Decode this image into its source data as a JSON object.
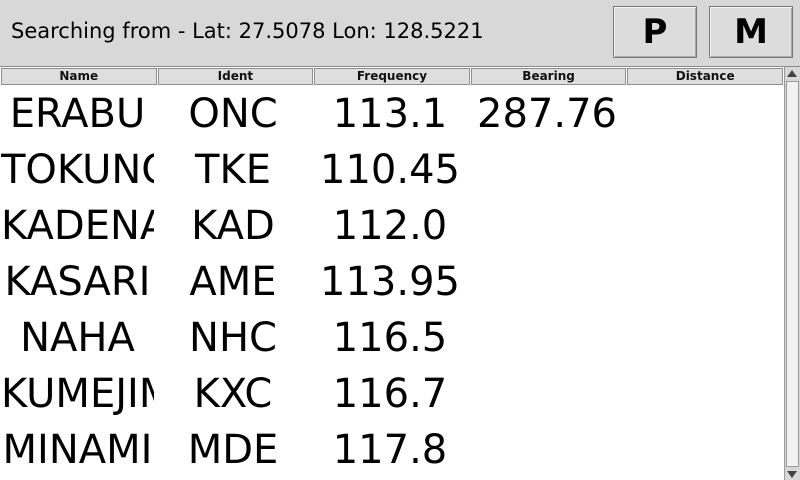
{
  "status": {
    "text": "Searching from - Lat: 27.5078 Lon: 128.5221"
  },
  "buttons": {
    "p_label": "P",
    "m_label": "M"
  },
  "table": {
    "columns": [
      "Name",
      "Ident",
      "Frequency",
      "Bearing",
      "Distance"
    ],
    "rows": [
      {
        "name": "ERABU",
        "ident": "ONC",
        "frequency": "113.1",
        "bearing": "287.76",
        "distance": ""
      },
      {
        "name": "TOKUNOSHIMA",
        "ident": "TKE",
        "frequency": "110.45",
        "bearing": "",
        "distance": ""
      },
      {
        "name": "KADENA",
        "ident": "KAD",
        "frequency": "112.0",
        "bearing": "",
        "distance": ""
      },
      {
        "name": "KASARI",
        "ident": "AME",
        "frequency": "113.95",
        "bearing": "",
        "distance": ""
      },
      {
        "name": "NAHA",
        "ident": "NHC",
        "frequency": "116.5",
        "bearing": "",
        "distance": ""
      },
      {
        "name": "KUMEJIMA",
        "ident": "KXC",
        "frequency": "116.7",
        "bearing": "",
        "distance": ""
      },
      {
        "name": "MINAMI",
        "ident": "MDE",
        "frequency": "117.8",
        "bearing": "",
        "distance": ""
      }
    ]
  }
}
